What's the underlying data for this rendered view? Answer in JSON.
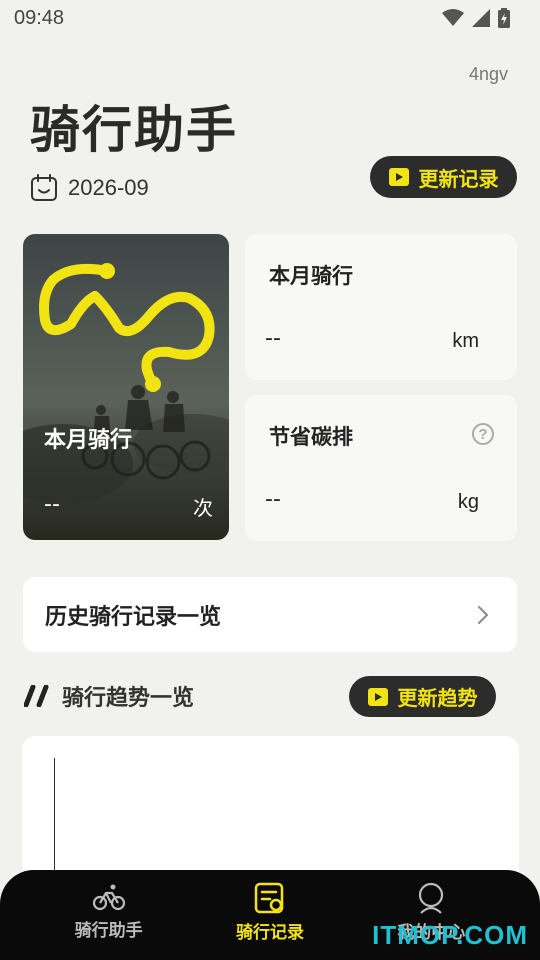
{
  "status_bar": {
    "time": "09:48"
  },
  "user_code": "4ngv",
  "app_title": "骑行助手",
  "date": "2026-09",
  "update_record_label": "更新记录",
  "photo_card": {
    "label": "本月骑行",
    "value": "--",
    "unit": "次"
  },
  "distance_card": {
    "label": "本月骑行",
    "value": "--",
    "unit": "km"
  },
  "carbon_card": {
    "label": "节省碳排",
    "value": "--",
    "unit": "kg",
    "help": "?"
  },
  "history_label": "历史骑行记录一览",
  "trend": {
    "title": "骑行趋势一览",
    "update_label": "更新趋势"
  },
  "nav": {
    "items": [
      {
        "label": "骑行助手",
        "icon": "bicycle-icon",
        "active": false
      },
      {
        "label": "骑行记录",
        "icon": "record-list-icon",
        "active": true
      },
      {
        "label": "我的中心",
        "icon": "user-icon",
        "active": false
      }
    ]
  },
  "watermark": "ITMOP.COM",
  "colors": {
    "accent": "#f2e313",
    "background": "#f1f1ee",
    "dark": "#2c2c2c",
    "nav_bg": "#0a0a0a"
  }
}
